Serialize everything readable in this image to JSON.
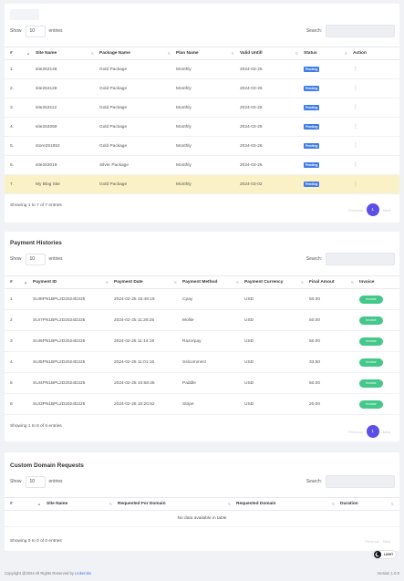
{
  "subscriptions": {
    "show_label": "Show",
    "length_value": "10",
    "entries_label": "entries",
    "search_label": "Search:",
    "headers": [
      "#",
      "Site Name",
      "Package Name",
      "Plan Name",
      "Valid Untill",
      "Status",
      "Action"
    ],
    "rows": [
      {
        "num": "1.",
        "site": "site253148",
        "package": "Gold Package",
        "plan": "Monthly",
        "valid": "2024-03-26",
        "status": "Pending"
      },
      {
        "num": "2.",
        "site": "site253128",
        "package": "Gold Package",
        "plan": "Monthly",
        "valid": "2024-03-26",
        "status": "Pending"
      },
      {
        "num": "3.",
        "site": "site253112",
        "package": "Gold Package",
        "plan": "Monthly",
        "valid": "2024-03-26",
        "status": "Pending"
      },
      {
        "num": "4.",
        "site": "site253059",
        "package": "Gold Package",
        "plan": "Monthly",
        "valid": "2024-03-26",
        "status": "Pending"
      },
      {
        "num": "5.",
        "site": "store251852",
        "package": "Gold Package",
        "plan": "Monthly",
        "valid": "2024-03-26",
        "status": "Pending"
      },
      {
        "num": "6.",
        "site": "site253019",
        "package": "Silver Package",
        "plan": "Monthly",
        "valid": "2024-03-26",
        "status": "Pending"
      },
      {
        "num": "7.",
        "site": "My Blog Site",
        "package": "Gold Package",
        "plan": "Monthly",
        "valid": "2024-03-02",
        "status": "Pending"
      }
    ],
    "info": "Showing 1 to 7 of 7 entries",
    "prev": "Previous",
    "page": "1",
    "next": "Next"
  },
  "payments": {
    "title": "Payment Histories",
    "show_label": "Show",
    "length_value": "10",
    "entries_label": "entries",
    "search_label": "Search:",
    "headers": [
      "#",
      "Payment ID",
      "Payment Date",
      "Payment Method",
      "Payment Currency",
      "Final Amout",
      "Invoice"
    ],
    "rows": [
      {
        "num": "1",
        "id": "SUI8PN1BPL2D2024D225",
        "date": "2024-02-25 15:48:19",
        "method": "Cpay",
        "currency": "USD",
        "amount": "50.00",
        "invoice": "Invoice"
      },
      {
        "num": "2",
        "id": "SUI7PN1BPL2D2024D225",
        "date": "2024-02-25 11:28:25",
        "method": "Mollie",
        "currency": "USD",
        "amount": "50.00",
        "invoice": "Invoice"
      },
      {
        "num": "3",
        "id": "SUI6PN1BPL2D2024D225",
        "date": "2024-02-25 11:14:19",
        "method": "Razorpay",
        "currency": "USD",
        "amount": "50.00",
        "invoice": "Invoice"
      },
      {
        "num": "4",
        "id": "SUI5PN1BPL2D2024D225",
        "date": "2024-02-25 11:01:16",
        "method": "Sslcommerz",
        "currency": "USD",
        "amount": "33.50",
        "invoice": "Invoice"
      },
      {
        "num": "5",
        "id": "SUI4PN1BPL2D2024D225",
        "date": "2024-02-25 10:58:45",
        "method": "Paddle",
        "currency": "USD",
        "amount": "50.00",
        "invoice": "Invoice"
      },
      {
        "num": "6",
        "id": "SUI3PN1BPL2D2024D225",
        "date": "2024-02-25 10:20:52",
        "method": "Stripe",
        "currency": "USD",
        "amount": "20.00",
        "invoice": "Invoice"
      }
    ],
    "info": "Showing 1 to 6 of 6 entries",
    "prev": "Previous",
    "page": "1",
    "next": "Next"
  },
  "domains": {
    "title": "Custom Domain Requests",
    "show_label": "Show",
    "length_value": "10",
    "entries_label": "entries",
    "search_label": "Search:",
    "headers": [
      "#",
      "Site Name",
      "Requested For Domain",
      "Requested Domain",
      "Duration"
    ],
    "empty": "No data available in table",
    "info": "Showing 0 to 0 of 0 entries",
    "prev": "Previous",
    "next": "Next"
  },
  "footer": {
    "copyright": "Copyright @2024 All Rights Reserved by",
    "brand": "Linkeroks",
    "version": "Version 1.0.0",
    "theme_label": "LIGHT"
  },
  "colors": {
    "pending_badge": "#3f7ce8",
    "invoice_button": "#43c88a",
    "highlight_row": "#fbf1c7",
    "pager_active": "#5b4fe8"
  }
}
